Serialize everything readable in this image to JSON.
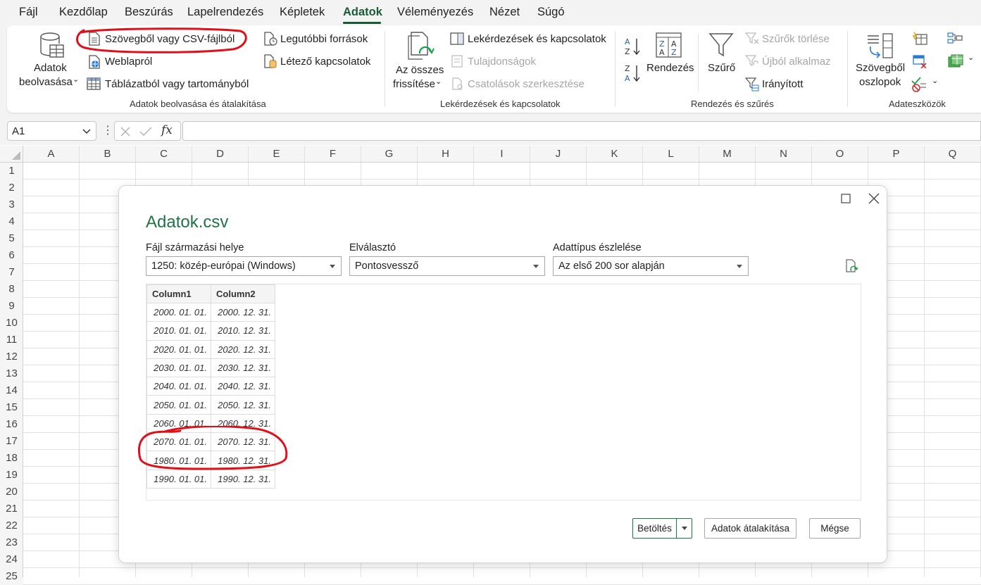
{
  "menu": {
    "items": [
      "Fájl",
      "Kezdőlap",
      "Beszúrás",
      "Lapelrendezés",
      "Képletek",
      "Adatok",
      "Véleményezés",
      "Nézet",
      "Súgó"
    ],
    "active": "Adatok"
  },
  "ribbon": {
    "get_data": {
      "main_label_1": "Adatok",
      "main_label_2": "beolvasása",
      "from_text_csv": "Szövegből vagy CSV-fájlból",
      "from_web": "Weblapról",
      "from_table": "Táblázatból vagy tartományból",
      "recent_sources": "Legutóbbi források",
      "existing_connections": "Létező kapcsolatok",
      "group_label": "Adatok beolvasása és átalakítása"
    },
    "queries": {
      "refresh_all_1": "Az összes",
      "refresh_all_2": "frissítése",
      "queries_connections": "Lekérdezések és kapcsolatok",
      "properties": "Tulajdonságok",
      "edit_links": "Csatolások szerkesztése",
      "group_label": "Lekérdezések és kapcsolatok"
    },
    "sort_filter": {
      "sort": "Rendezés",
      "filter": "Szűrő",
      "clear": "Szűrők törlése",
      "reapply": "Újból alkalmaz",
      "advanced": "Irányított",
      "group_label": "Rendezés és szűrés"
    },
    "data_tools": {
      "text_to_columns_1": "Szövegből",
      "text_to_columns_2": "oszlopok",
      "group_label": "Adateszközök"
    }
  },
  "formula_bar": {
    "name_box": "A1",
    "fx": "fx",
    "value": ""
  },
  "grid": {
    "columns": [
      "A",
      "B",
      "C",
      "D",
      "E",
      "F",
      "G",
      "H",
      "I",
      "J",
      "K",
      "L",
      "M",
      "N",
      "O",
      "P",
      "Q"
    ],
    "rows": [
      "1",
      "2",
      "3",
      "4",
      "5",
      "6",
      "7",
      "8",
      "9",
      "10",
      "11",
      "12",
      "13",
      "14",
      "15",
      "16",
      "17",
      "18",
      "19",
      "20",
      "21",
      "22",
      "23",
      "24",
      "25"
    ]
  },
  "dialog": {
    "title": "Adatok.csv",
    "origin_label": "Fájl származási helye",
    "origin_value": "1250: közép-európai (Windows)",
    "delimiter_label": "Elválasztó",
    "delimiter_value": "Pontosvessző",
    "detect_label": "Adattípus észlelése",
    "detect_value": "Az első 200 sor alapján",
    "preview": {
      "headers": [
        "Column1",
        "Column2"
      ],
      "rows": [
        [
          "2000. 01. 01.",
          "2000. 12. 31."
        ],
        [
          "2010. 01. 01.",
          "2010. 12. 31."
        ],
        [
          "2020. 01. 01.",
          "2020. 12. 31."
        ],
        [
          "2030. 01. 01.",
          "2030. 12. 31."
        ],
        [
          "2040. 01. 01.",
          "2040. 12. 31."
        ],
        [
          "2050. 01. 01.",
          "2050. 12. 31."
        ],
        [
          "2060. 01. 01.",
          "2060. 12. 31."
        ],
        [
          "2070. 01. 01.",
          "2070. 12. 31."
        ],
        [
          "1980. 01. 01.",
          "1980. 12. 31."
        ],
        [
          "1990. 01. 01.",
          "1990. 12. 31."
        ]
      ]
    },
    "buttons": {
      "load": "Betöltés",
      "transform": "Adatok átalakítása",
      "cancel": "Mégse"
    }
  },
  "colors": {
    "accent": "#217346",
    "tab_active": "#185c37",
    "annotation": "#e0101a"
  }
}
